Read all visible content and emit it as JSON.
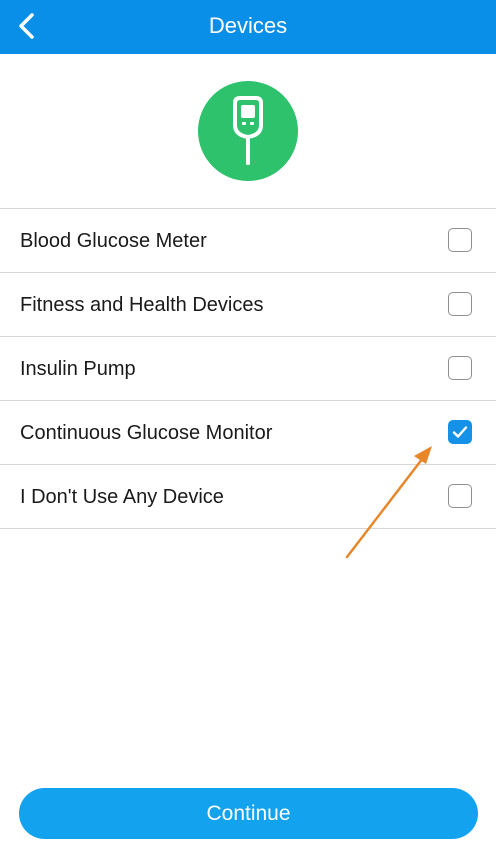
{
  "header": {
    "title": "Devices",
    "back_icon": "chevron-left-icon"
  },
  "hero": {
    "icon": "glucose-meter-icon",
    "circle_color": "#2dc26b"
  },
  "devices": [
    {
      "label": "Blood Glucose Meter",
      "checked": false
    },
    {
      "label": "Fitness and Health Devices",
      "checked": false
    },
    {
      "label": "Insulin Pump",
      "checked": false
    },
    {
      "label": "Continuous Glucose Monitor",
      "checked": true
    },
    {
      "label": "I Don't Use Any Device",
      "checked": false
    }
  ],
  "footer": {
    "continue_label": "Continue"
  },
  "colors": {
    "header": "#0a8fe8",
    "accent": "#12a2ee",
    "checked": "#1592e8",
    "annotation_arrow": "#e8862a"
  }
}
